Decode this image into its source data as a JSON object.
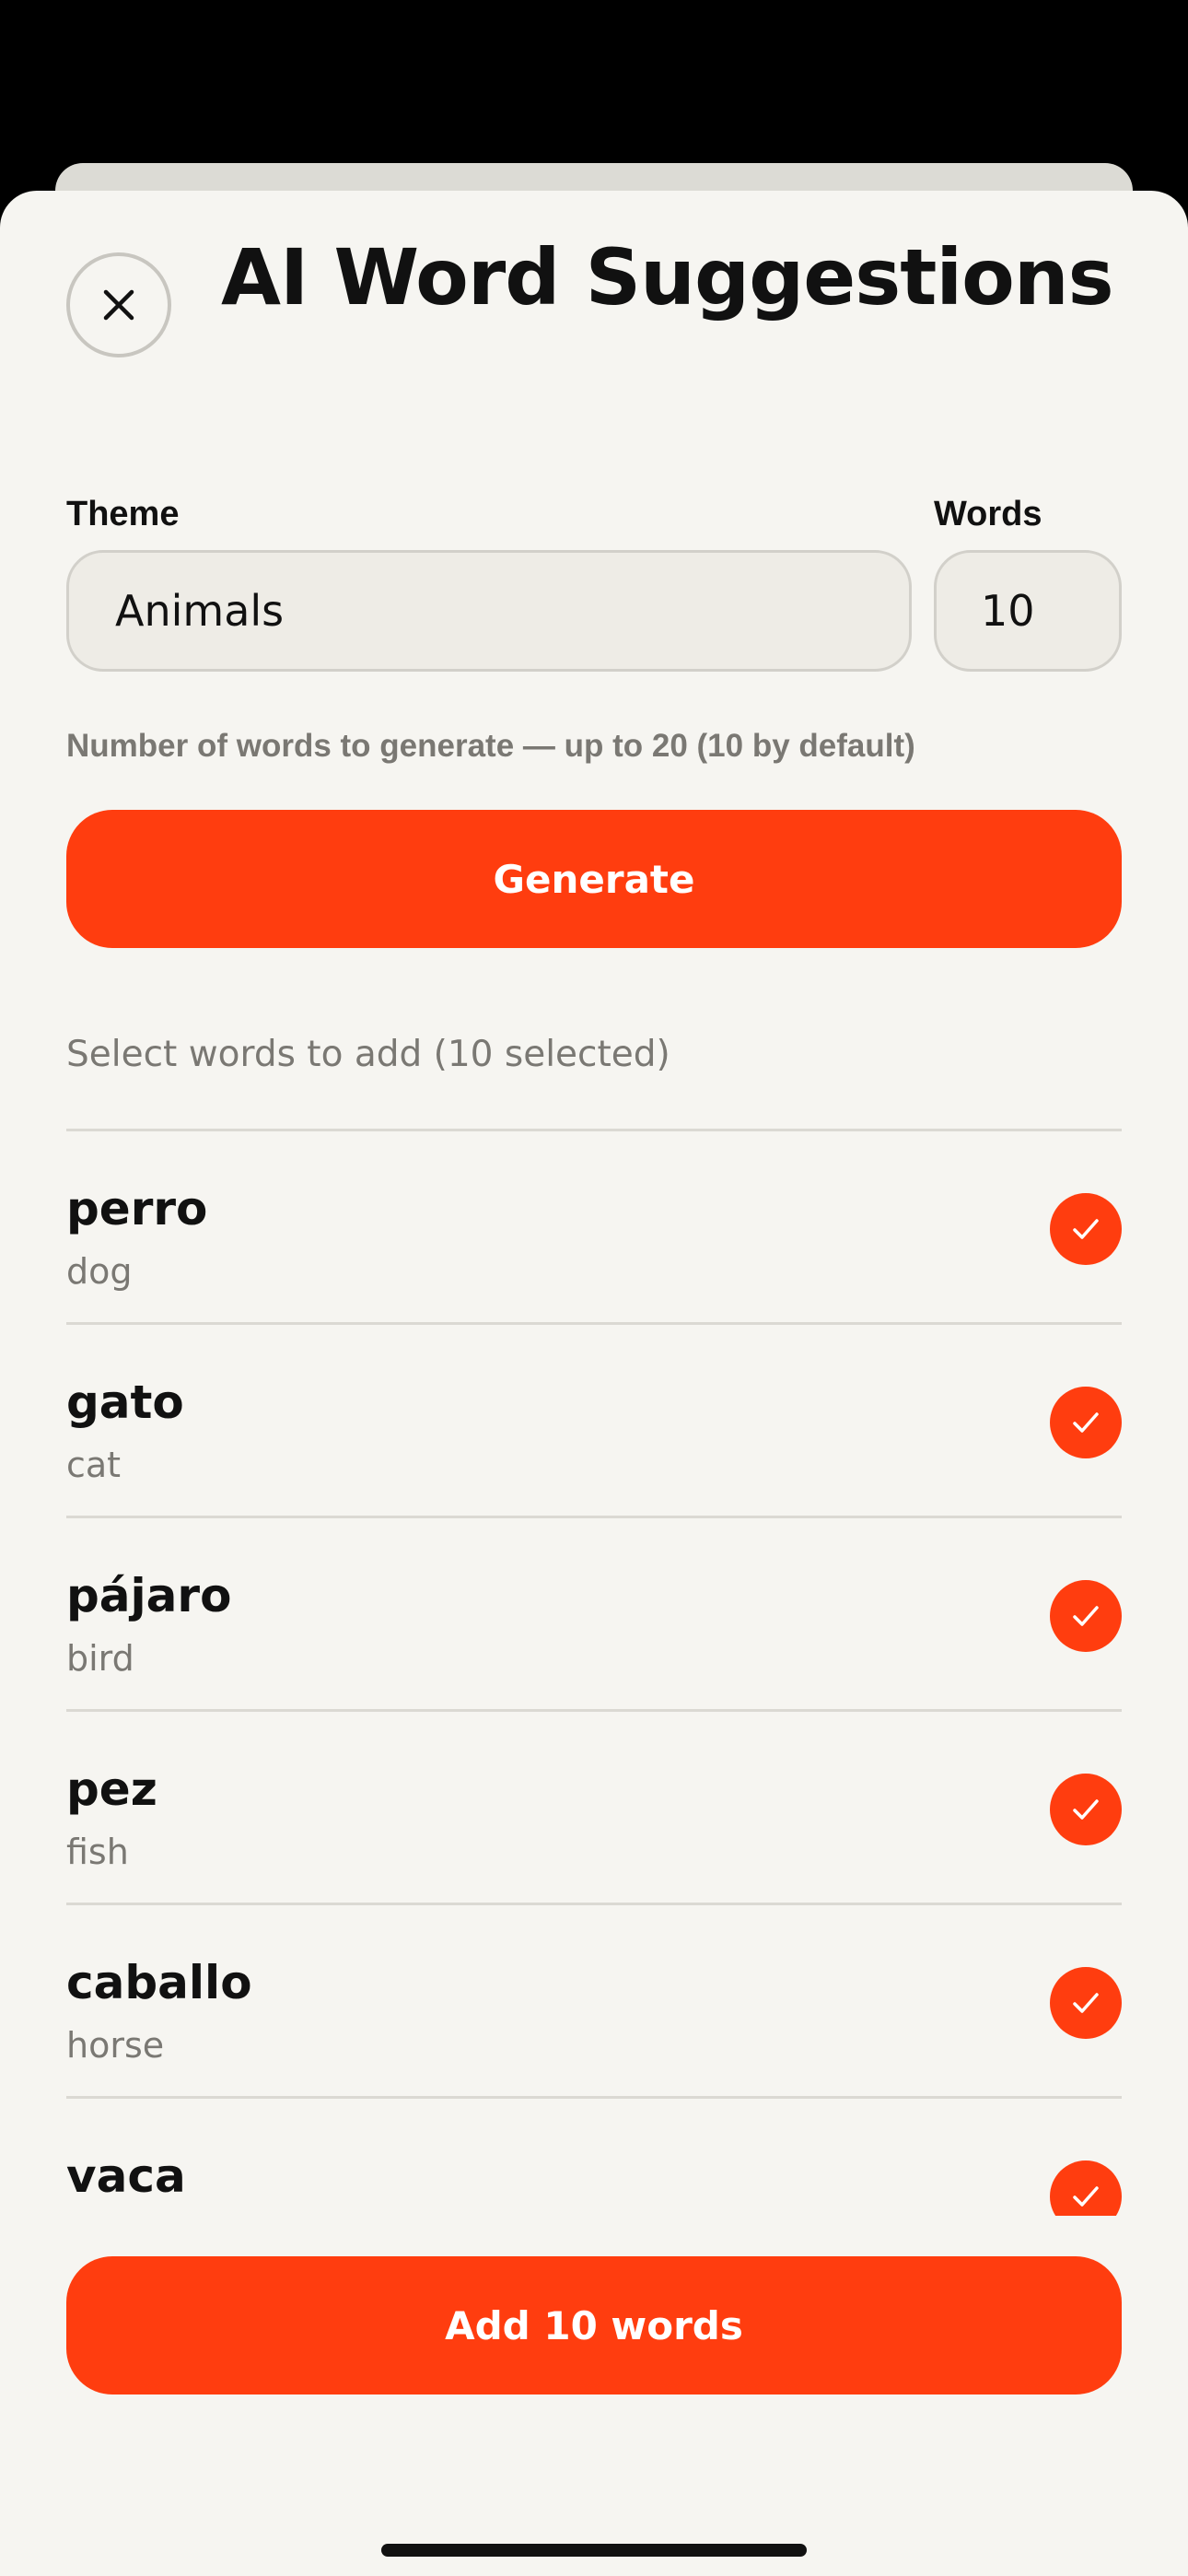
{
  "header": {
    "title": "AI Word Suggestions",
    "close_icon": "close-icon"
  },
  "form": {
    "theme_label": "Theme",
    "theme_value": "Animals",
    "words_label": "Words",
    "words_value": "10",
    "helper": "Number of words to generate — up to 20 (10 by default)",
    "generate_label": "Generate"
  },
  "list": {
    "label": "Select words to add (10 selected)",
    "items": [
      {
        "word": "perro",
        "translation": "dog",
        "selected": true
      },
      {
        "word": "gato",
        "translation": "cat",
        "selected": true
      },
      {
        "word": "pájaro",
        "translation": "bird",
        "selected": true
      },
      {
        "word": "pez",
        "translation": "fish",
        "selected": true
      },
      {
        "word": "caballo",
        "translation": "horse",
        "selected": true
      },
      {
        "word": "vaca",
        "translation": "",
        "selected": true
      }
    ]
  },
  "footer": {
    "add_label": "Add 10 words"
  },
  "colors": {
    "accent": "#ff3d0f",
    "background": "#f6f5f1",
    "input_bg": "#eeece6",
    "muted_text": "#7a7873"
  }
}
